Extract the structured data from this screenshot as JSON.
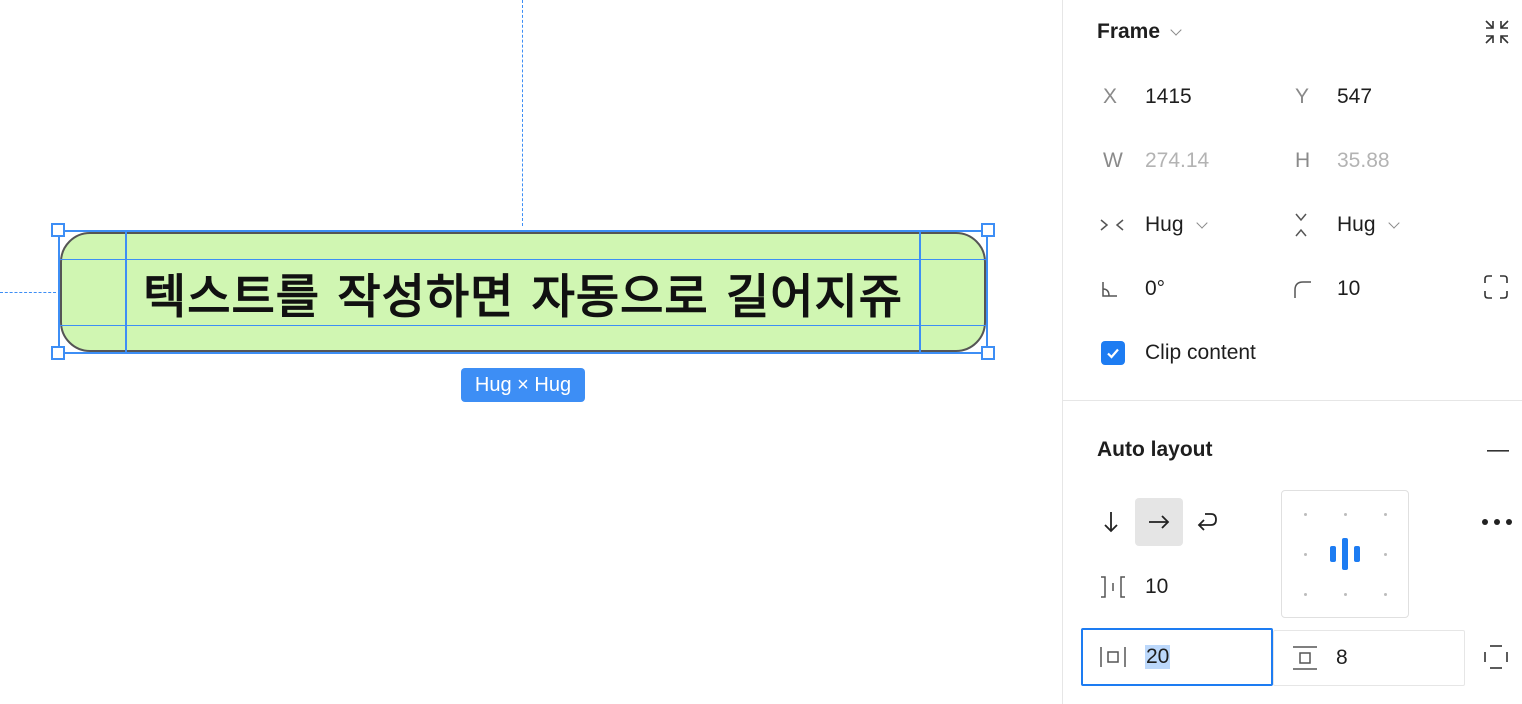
{
  "canvas": {
    "frame_text": "텍스트를 작성하면 자동으로 길어지쥬",
    "size_badge": "Hug × Hug",
    "frame_fill": "#d0f6b2",
    "selection_color": "#3d8ef5"
  },
  "panel": {
    "frame": {
      "title": "Frame",
      "x_label": "X",
      "x_value": "1415",
      "y_label": "Y",
      "y_value": "547",
      "w_label": "W",
      "w_value": "274.14",
      "h_label": "H",
      "h_value": "35.88",
      "width_mode": "Hug",
      "height_mode": "Hug",
      "rotation": "0°",
      "corner_radius": "10",
      "clip_label": "Clip content",
      "clip_checked": true
    },
    "auto_layout": {
      "title": "Auto layout",
      "direction_selected": "horizontal",
      "gap": "10",
      "padding_horizontal": "20",
      "padding_vertical": "8"
    }
  },
  "icons": [
    "collapse-icon",
    "chevron-down-icon",
    "hug-width-icon",
    "hug-height-icon",
    "rotation-icon",
    "corner-radius-icon",
    "independent-corners-icon",
    "checkmark-icon",
    "minus-icon",
    "arrow-down-icon",
    "arrow-right-icon",
    "wrap-icon",
    "spacing-icon",
    "alignment-center-icon",
    "more-icon",
    "horizontal-padding-icon",
    "vertical-padding-icon",
    "individual-padding-icon"
  ]
}
